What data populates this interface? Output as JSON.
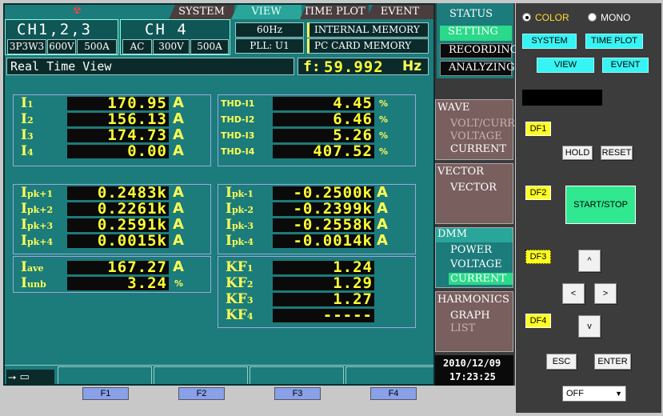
{
  "tabs": [
    "SYSTEM",
    "VIEW",
    "TIME PLOT",
    "EVENT"
  ],
  "channels": {
    "ch123": "CH1,2,3",
    "ch4": "CH 4",
    "wiring": "3P3W3",
    "voltage": "600V",
    "current": "500A",
    "ch4_mode": "AC",
    "ch4_voltage": "300V",
    "ch4_current": "500A"
  },
  "freq_setting": "60Hz",
  "pll": "PLL: U1",
  "memory": [
    "INTERNAL MEMORY",
    "PC CARD  MEMORY"
  ],
  "view_title": "Real Time View",
  "frequency": {
    "label": "f:",
    "value": "59.992",
    "unit": "Hz"
  },
  "currents": [
    {
      "label": "I",
      "sub": "1",
      "value": "170.95",
      "unit": "A"
    },
    {
      "label": "I",
      "sub": "2",
      "value": "156.13",
      "unit": "A"
    },
    {
      "label": "I",
      "sub": "3",
      "value": "174.73",
      "unit": "A"
    },
    {
      "label": "I",
      "sub": "4",
      "value": "0.00",
      "unit": "A"
    }
  ],
  "thd": [
    {
      "label": "THD-I1",
      "value": "4.45",
      "unit": "%"
    },
    {
      "label": "THD-I2",
      "value": "6.46",
      "unit": "%"
    },
    {
      "label": "THD-I3",
      "value": "5.26",
      "unit": "%"
    },
    {
      "label": "THD-I4",
      "value": "407.52",
      "unit": "%"
    }
  ],
  "ipk_pos": [
    {
      "label": "I",
      "sub": "pk+1",
      "value": "0.2483k",
      "unit": "A"
    },
    {
      "label": "I",
      "sub": "pk+2",
      "value": "0.2261k",
      "unit": "A"
    },
    {
      "label": "I",
      "sub": "pk+3",
      "value": "0.2591k",
      "unit": "A"
    },
    {
      "label": "I",
      "sub": "pk+4",
      "value": "0.0015k",
      "unit": "A"
    }
  ],
  "ipk_neg": [
    {
      "label": "I",
      "sub": "pk-1",
      "value": "-0.2500k",
      "unit": "A"
    },
    {
      "label": "I",
      "sub": "pk-2",
      "value": "-0.2399k",
      "unit": "A"
    },
    {
      "label": "I",
      "sub": "pk-3",
      "value": "-0.2558k",
      "unit": "A"
    },
    {
      "label": "I",
      "sub": "pk-4",
      "value": "-0.0014k",
      "unit": "A"
    }
  ],
  "iave": {
    "label": "I",
    "sub": "ave",
    "value": "167.27",
    "unit": "A"
  },
  "iunb": {
    "label": "I",
    "sub": "unb",
    "value": "3.24",
    "unit": "%"
  },
  "kf": [
    {
      "label": "KF",
      "sub": "1",
      "value": "1.24"
    },
    {
      "label": "KF",
      "sub": "2",
      "value": "1.29"
    },
    {
      "label": "KF",
      "sub": "3",
      "value": "1.27"
    },
    {
      "label": "KF",
      "sub": "4",
      "value": "-----"
    }
  ],
  "status": {
    "title": "STATUS",
    "items": [
      "SETTING",
      "RECORDING",
      "ANALYZING"
    ]
  },
  "wave": {
    "title": "WAVE",
    "items": [
      "VOLT/CURR",
      "VOLTAGE",
      "CURRENT"
    ]
  },
  "vector": {
    "title": "VECTOR",
    "items": [
      "VECTOR"
    ]
  },
  "dmm": {
    "title": "DMM",
    "items": [
      "POWER",
      "VOLTAGE",
      "CURRENT"
    ]
  },
  "harmonics": {
    "title": "HARMONICS",
    "items": [
      "GRAPH",
      "LIST"
    ]
  },
  "datetime": {
    "date": "2010/12/09",
    "time": "17:23:25"
  },
  "fkeys": [
    "F1",
    "F2",
    "F3",
    "F4"
  ],
  "control": {
    "color_label": "COLOR",
    "mono_label": "MONO",
    "system": "SYSTEM",
    "time_plot": "TIME PLOT",
    "view": "VIEW",
    "event": "EVENT",
    "df1": "DF1",
    "df2": "DF2",
    "df3": "DF3",
    "df4": "DF4",
    "hold": "HOLD",
    "reset": "RESET",
    "start_stop": "START/STOP",
    "up": "^",
    "down": "v",
    "left": "<",
    "right": ">",
    "esc": "ESC",
    "enter": "ENTER",
    "off_select": "OFF"
  },
  "colors": {
    "screen_bg": "#1c7b7b",
    "value_text": "#ffff33",
    "accent_cyan": "#37f3f3",
    "df_yellow": "#ffff20",
    "start_green": "#30e890"
  }
}
